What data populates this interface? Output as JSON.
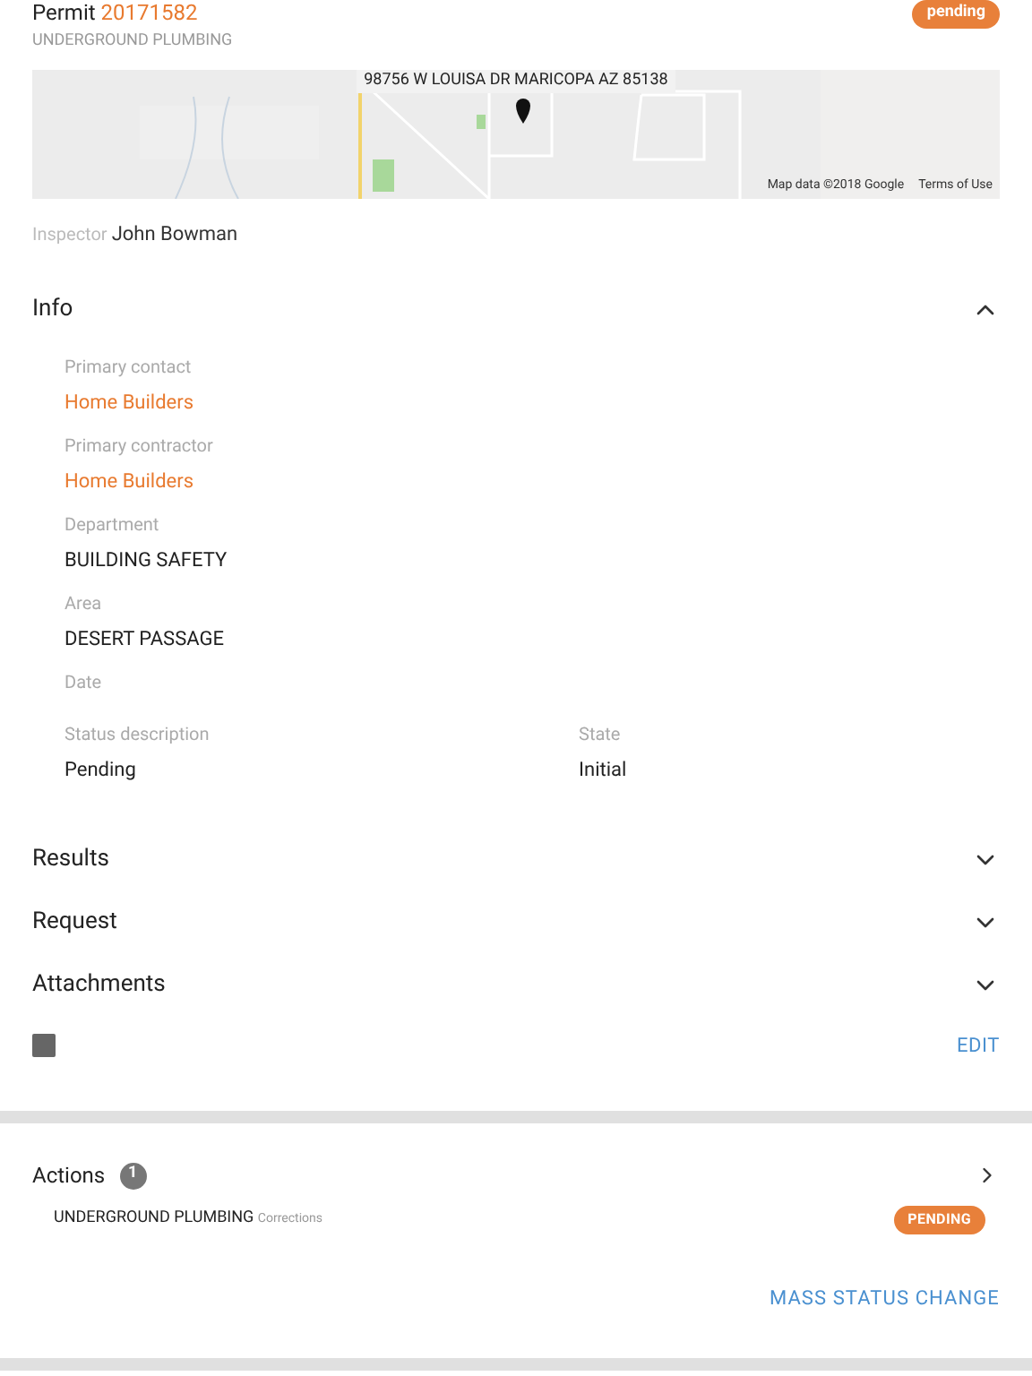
{
  "header": {
    "label": "Permit",
    "number": "20171582",
    "subtitle": "UNDERGROUND PLUMBING",
    "status": "pending"
  },
  "map": {
    "address": "98756 W LOUISA DR MARICOPA AZ 85138",
    "attribution": "Map data ©2018 Google",
    "terms": "Terms of Use"
  },
  "inspector": {
    "label": "Inspector",
    "name": "John Bowman"
  },
  "sections": [
    {
      "title": "Info",
      "expanded": true,
      "fields": [
        {
          "label": "Primary contact",
          "value": "Home Builders",
          "kind": "link"
        },
        {
          "label": "Primary contractor",
          "value": "Home Builders",
          "kind": "link"
        },
        {
          "label": "Department",
          "value": "BUILDING SAFETY",
          "kind": "text"
        },
        {
          "label": "Area",
          "value": "DESERT PASSAGE",
          "kind": "text"
        },
        {
          "label": "Date"
        }
      ],
      "pairs": [
        {
          "label": "Status description",
          "value": "Pending"
        },
        {
          "label": "State",
          "value": "Initial"
        }
      ]
    },
    {
      "title": "Results",
      "expanded": false
    },
    {
      "title": "Request",
      "expanded": false
    },
    {
      "title": "Attachments",
      "expanded": false
    }
  ],
  "edit_button": "EDIT",
  "actions": {
    "title": "Actions",
    "count": "1",
    "items": [
      {
        "name": "UNDERGROUND PLUMBING",
        "type": "Corrections",
        "status": "PENDING"
      }
    ],
    "button": "MASS STATUS CHANGE"
  }
}
